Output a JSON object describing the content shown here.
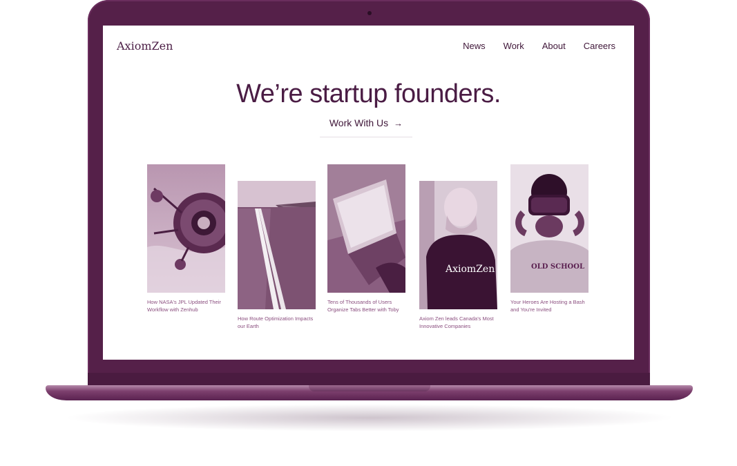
{
  "brand": {
    "logo": "AxiomZen"
  },
  "nav": {
    "items": [
      "News",
      "Work",
      "About",
      "Careers"
    ]
  },
  "hero": {
    "headline": "We’re startup founders.",
    "cta_label": "Work With Us",
    "cta_arrow": "→"
  },
  "cards": [
    {
      "caption": "How NASA's JPL Updated Their Workflow with Zenhub",
      "image": "satellite"
    },
    {
      "caption": "How Route Optimization Impacts our Earth",
      "image": "road"
    },
    {
      "caption": "Tens of Thousands of Users Organize Tabs Better with Toby",
      "image": "laptop"
    },
    {
      "caption": "Axiom Zen leads Canada's Most Innovative Companies",
      "image": "axiomzen-shirt",
      "shirt_text": "AxiomZen"
    },
    {
      "caption": "Your Heroes Are Hosting a Bash and You're Invited",
      "image": "vr-headset",
      "shirt_text": "OLD SCHOOL"
    }
  ],
  "colors": {
    "laptop": "#552049",
    "text": "#4a1c44",
    "caption": "#8a4d7e"
  }
}
